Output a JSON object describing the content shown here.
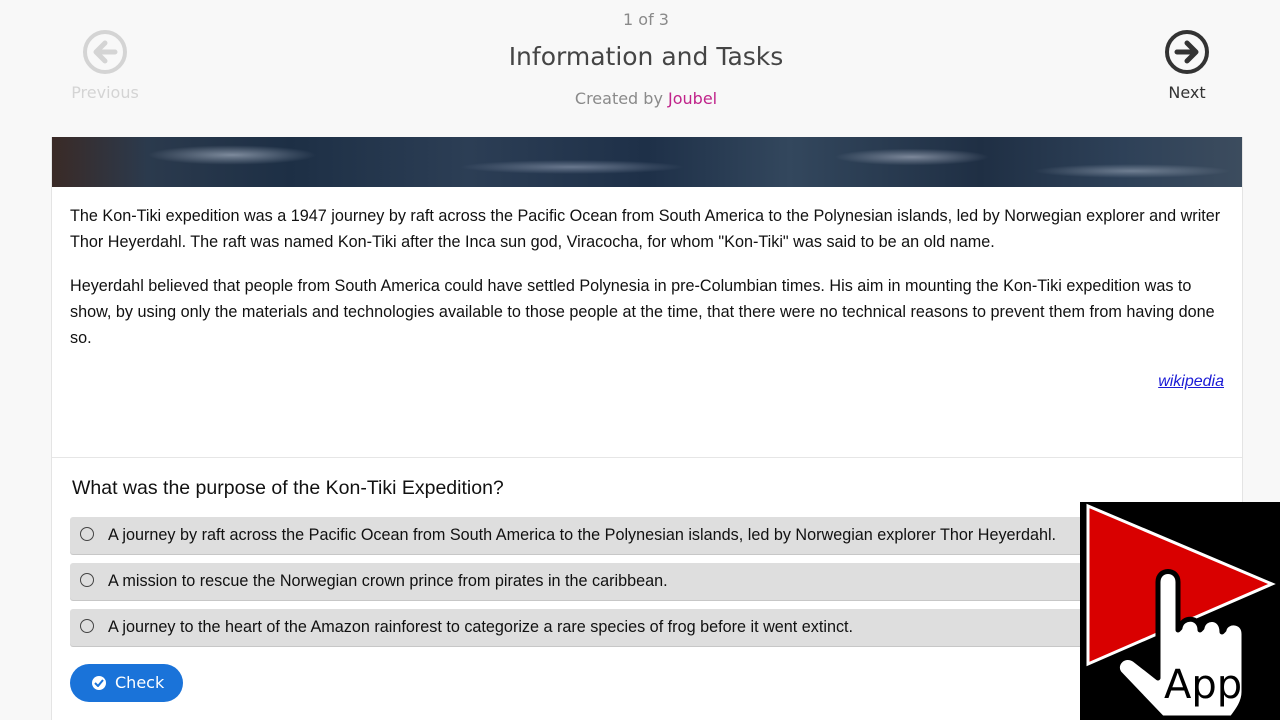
{
  "header": {
    "counter": "1 of 3",
    "title": "Information and Tasks",
    "created_by_prefix": "Created by",
    "author": "Joubel",
    "prev_label": "Previous",
    "next_label": "Next",
    "prev_icon": "arrow-left-circle-icon",
    "next_icon": "arrow-right-circle-icon"
  },
  "article": {
    "paragraphs": [
      "The Kon-Tiki expedition was a 1947 journey by raft across the Pacific Ocean from South America to the Polynesian islands, led by Norwegian explorer and writer Thor Heyerdahl. The raft was named Kon-Tiki after the Inca sun god, Viracocha, for whom \"Kon-Tiki\" was said to be an old name.",
      "Heyerdahl believed that people from South America could have settled Polynesia in pre-Columbian times. His aim in mounting the Kon-Tiki expedition was to show, by using only the materials and technologies available to those people at the time, that there were no technical reasons to prevent them from having done so."
    ],
    "source_link": "wikipedia"
  },
  "quiz": {
    "question": "What was the purpose of the Kon-Tiki Expedition?",
    "answers": [
      "A journey by raft across the Pacific Ocean from South America to the Polynesian islands, led by Norwegian explorer Thor Heyerdahl.",
      "A mission to rescue the Norwegian crown prince from pirates in the caribbean.",
      "A journey to the heart of the Amazon rainforest to categorize a rare species of frog before it went extinct."
    ],
    "check_label": "Check"
  },
  "badge": {
    "label": "App"
  },
  "colors": {
    "accent_blue": "#1a73d9",
    "author_pink": "#c0238a",
    "badge_red": "#e00000",
    "link_blue": "#1a1ad6"
  }
}
